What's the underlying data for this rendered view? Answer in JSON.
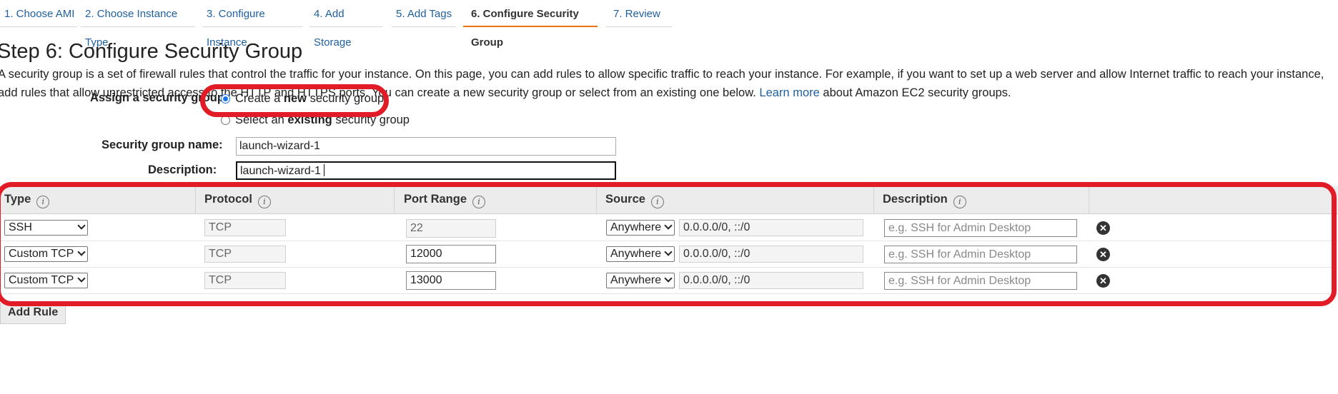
{
  "wizard_tabs": [
    {
      "label": "1. Choose AMI"
    },
    {
      "label": "2. Choose Instance Type"
    },
    {
      "label": "3. Configure Instance"
    },
    {
      "label": "4. Add Storage"
    },
    {
      "label": "5. Add Tags"
    },
    {
      "label": "6. Configure Security Group"
    },
    {
      "label": "7. Review"
    }
  ],
  "page": {
    "title": "Step 6: Configure Security Group",
    "intro": "A security group is a set of firewall rules that control the traffic for your instance. On this page, you can add rules to allow specific traffic to reach your instance. For example, if you want to set up a web server and allow Internet traffic to reach your instance, add rules that allow unrestricted access to the HTTP and HTTPS ports. You can create a new security group or select from an existing one below.",
    "learn_more": "Learn more",
    "intro_tail": "about Amazon EC2 security groups."
  },
  "assign": {
    "label": "Assign a security group:",
    "option_new_pre": "Create a",
    "option_new_bold": "new",
    "option_new_post": "security group",
    "option_existing_pre": "Select an",
    "option_existing_bold": "existing",
    "option_existing_post": "security group"
  },
  "form": {
    "name_label": "Security group name:",
    "name_value": "launch-wizard-1",
    "description_label": "Description:",
    "description_value": "launch-wizard-1"
  },
  "table": {
    "headers": {
      "type": "Type",
      "protocol": "Protocol",
      "port_range": "Port Range",
      "source": "Source",
      "description": "Description"
    },
    "rows": [
      {
        "type": "SSH",
        "protocol": "TCP",
        "port": "22",
        "source_mode": "Anywhere",
        "source_cidr": "0.0.0.0/0, ::/0",
        "desc_placeholder": "e.g. SSH for Admin Desktop"
      },
      {
        "type": "Custom TCP R",
        "protocol": "TCP",
        "port": "12000",
        "source_mode": "Anywhere",
        "source_cidr": "0.0.0.0/0, ::/0",
        "desc_placeholder": "e.g. SSH for Admin Desktop"
      },
      {
        "type": "Custom TCP R",
        "protocol": "TCP",
        "port": "13000",
        "source_mode": "Anywhere",
        "source_cidr": "0.0.0.0/0, ::/0",
        "desc_placeholder": "e.g. SSH for Admin Desktop"
      }
    ]
  },
  "add_rule_label": "Add Rule",
  "colors": {
    "link": "#1f5f9e",
    "active_tab_underline": "#ec7211",
    "annotation": "#e21c26"
  }
}
